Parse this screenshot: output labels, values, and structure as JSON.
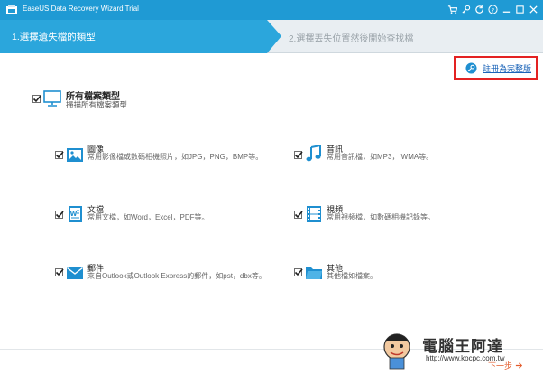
{
  "window": {
    "title": "EaseUS Data Recovery Wizard Trial"
  },
  "steps": {
    "step1": "1.選擇遺失檔的類型",
    "step2": "2.選擇丟失位置然後開始查找檔"
  },
  "register": {
    "label": "註冊為完整版"
  },
  "all_types": {
    "title": "所有檔案類型",
    "desc": "掃描所有檔案類型",
    "checked": true
  },
  "categories": [
    {
      "title": "圖像",
      "desc": "常用影像檔或數碼相機照片，如JPG，PNG，BMP等。",
      "checked": true,
      "icon": "image-icon"
    },
    {
      "title": "音訊",
      "desc": "常用音訊檔，如MP3， WMA等。",
      "checked": true,
      "icon": "music-note-icon"
    },
    {
      "title": "文檔",
      "desc": "常用文檔，如Word，Excel，PDF等。",
      "checked": true,
      "icon": "document-icon"
    },
    {
      "title": "視頻",
      "desc": "常用視頻檔，如數碼相機記錄等。",
      "checked": true,
      "icon": "film-icon"
    },
    {
      "title": "郵件",
      "desc": "來自Outlook或Outlook Express的郵件，如pst，dbx等。",
      "checked": true,
      "icon": "envelope-icon"
    },
    {
      "title": "其他",
      "desc": "其他檔如檔案。",
      "checked": true,
      "icon": "folder-icon"
    }
  ],
  "footer": {
    "next_label": "下一步"
  },
  "watermark": {
    "text": "電腦王阿達",
    "url": "http://www.kocpc.com.tw"
  },
  "colors": {
    "titlebar": "#1f9ad4",
    "step_active": "#2ba6dc",
    "register_border": "#e32222",
    "link": "#1a63b8",
    "icon_blue": "#1f8fd0"
  }
}
